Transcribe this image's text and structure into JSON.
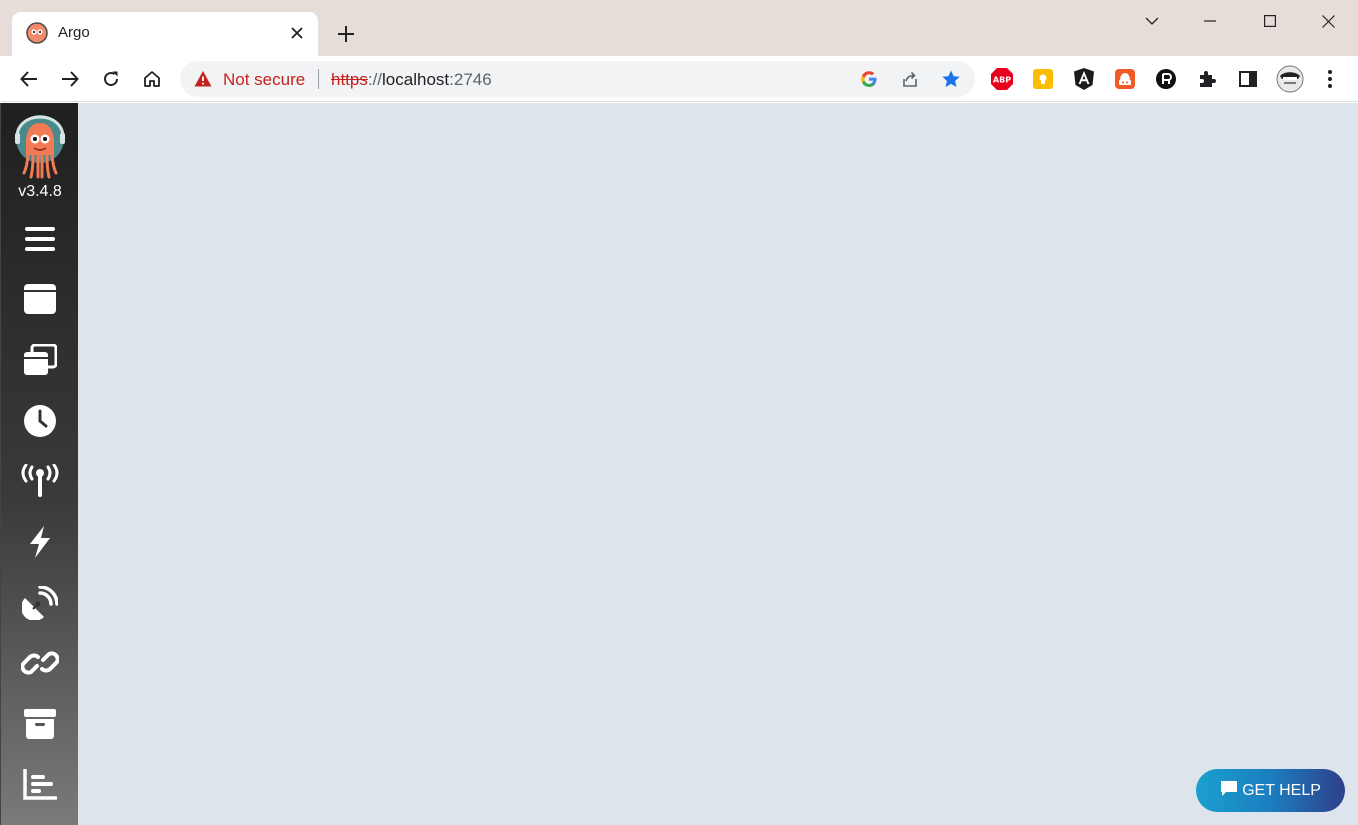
{
  "browser": {
    "tab": {
      "title": "Argo"
    },
    "address_bar": {
      "security_label": "Not secure",
      "url_scheme": "https",
      "url_separator": "://",
      "url_host": "localhost",
      "url_port": ":2746"
    },
    "extensions": [
      "adblock-plus-icon",
      "keep-icon",
      "angular-icon",
      "vpn-icon",
      "privacy-icon",
      "puzzle-icon",
      "sidepanel-icon",
      "profile-avatar"
    ]
  },
  "app": {
    "version": "v3.4.8",
    "nav_items": [
      {
        "name": "menu-toggle",
        "icon": "hamburger-icon"
      },
      {
        "name": "workflows",
        "icon": "window-icon"
      },
      {
        "name": "workflow-templates",
        "icon": "stacked-windows-icon"
      },
      {
        "name": "cron-workflows",
        "icon": "clock-icon"
      },
      {
        "name": "event-sources",
        "icon": "broadcast-icon"
      },
      {
        "name": "sensors",
        "icon": "bolt-icon"
      },
      {
        "name": "event-flow",
        "icon": "satellite-dish-icon"
      },
      {
        "name": "links",
        "icon": "link-icon"
      },
      {
        "name": "archived-workflows",
        "icon": "archive-icon"
      },
      {
        "name": "reports",
        "icon": "bar-chart-icon"
      }
    ],
    "help_button": {
      "label": "GET HELP"
    }
  },
  "colors": {
    "sidebar": "#2b2b2b",
    "main_background": "#dee4eb",
    "help_gradient_start": "#1aa0cf",
    "help_gradient_end": "#2f3f8a",
    "security_warning": "#c5221f"
  }
}
